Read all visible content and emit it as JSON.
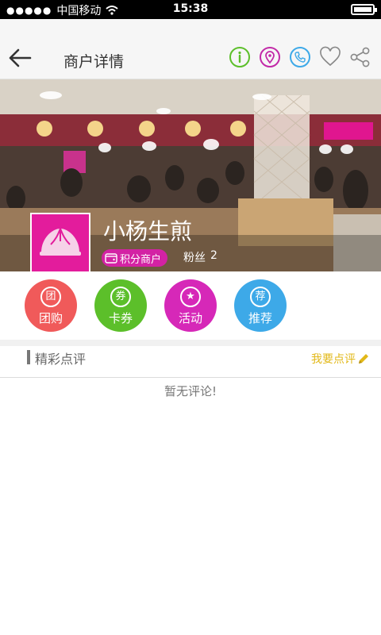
{
  "status_bar": {
    "carrier": "中国移动",
    "time": "15:38"
  },
  "nav": {
    "title": "商户详情",
    "icons": [
      "info-icon",
      "location-pin-icon",
      "phone-icon",
      "heart-icon",
      "share-icon"
    ]
  },
  "shop": {
    "name": "小杨生煎",
    "badge": "积分商户",
    "fans_label": "粉丝",
    "fans_count": "2"
  },
  "actions": [
    {
      "label": "团购",
      "icon_char": "团",
      "color": "#f05a5a"
    },
    {
      "label": "卡券",
      "icon_char": "券",
      "color": "#5cbf2a"
    },
    {
      "label": "活动",
      "icon_char": "★",
      "color": "#d628b8"
    },
    {
      "label": "推荐",
      "icon_char": "荐",
      "color": "#3da9e8"
    }
  ],
  "reviews": {
    "title": "精彩点评",
    "write_label": "我要点评",
    "empty_text": "暂无评论!"
  }
}
